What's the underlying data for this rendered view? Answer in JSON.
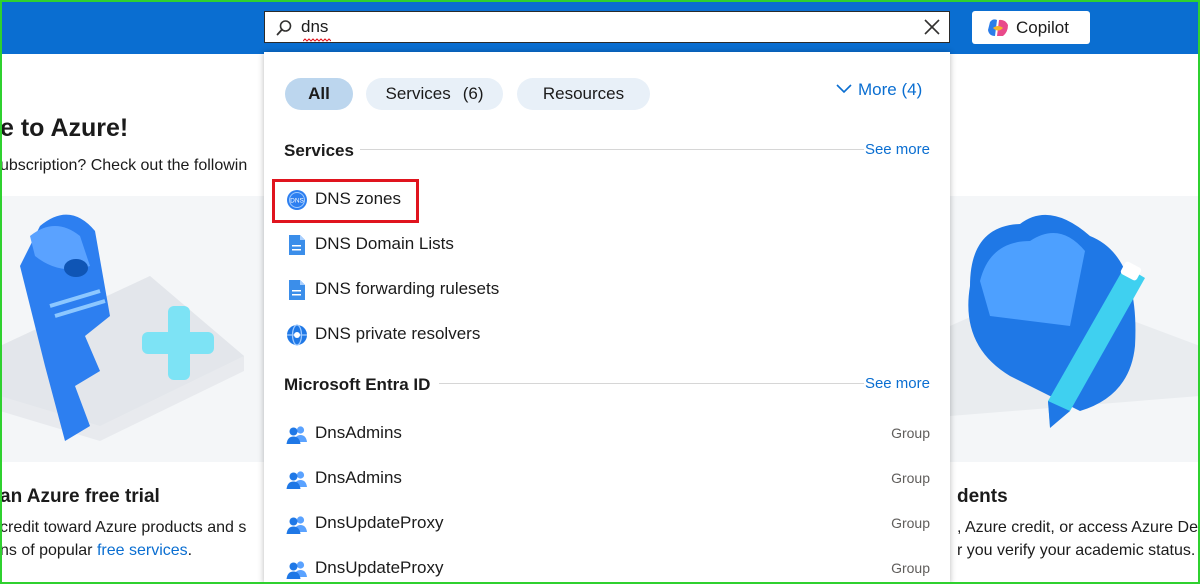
{
  "search": {
    "value": "dns",
    "placeholder": ""
  },
  "copilot": {
    "label": "Copilot"
  },
  "background": {
    "title": "e to Azure!",
    "subtitle": "ubscription? Check out the followin",
    "left_card": {
      "title": "an Azure free trial",
      "line1": "credit toward Azure products and s",
      "line2_prefix": "ns of popular ",
      "line2_link": "free services",
      "line2_suffix": "."
    },
    "right_card": {
      "title": "dents",
      "line1": ", Azure credit, or access Azure De",
      "line2": "r you verify your academic status."
    }
  },
  "filters": {
    "all": "All",
    "services": "Services",
    "services_count": "(6)",
    "resources": "Resources",
    "more": "More (4)"
  },
  "sections": {
    "services": {
      "title": "Services",
      "see_more": "See more",
      "items": [
        {
          "label": "DNS zones",
          "icon": "dns-zones-icon"
        },
        {
          "label": "DNS Domain Lists",
          "icon": "document-icon"
        },
        {
          "label": "DNS forwarding rulesets",
          "icon": "document-icon"
        },
        {
          "label": "DNS private resolvers",
          "icon": "globe-icon"
        }
      ]
    },
    "entra": {
      "title": "Microsoft Entra ID",
      "see_more": "See more",
      "items": [
        {
          "label": "DnsAdmins",
          "type": "Group",
          "icon": "group-icon"
        },
        {
          "label": "DnsAdmins",
          "type": "Group",
          "icon": "group-icon"
        },
        {
          "label": "DnsUpdateProxy",
          "type": "Group",
          "icon": "group-icon"
        },
        {
          "label": "DnsUpdateProxy",
          "type": "Group",
          "icon": "group-icon"
        }
      ]
    }
  },
  "colors": {
    "topbar": "#0a6ed1",
    "link": "#0a6ed1",
    "highlight": "#e0141e"
  }
}
